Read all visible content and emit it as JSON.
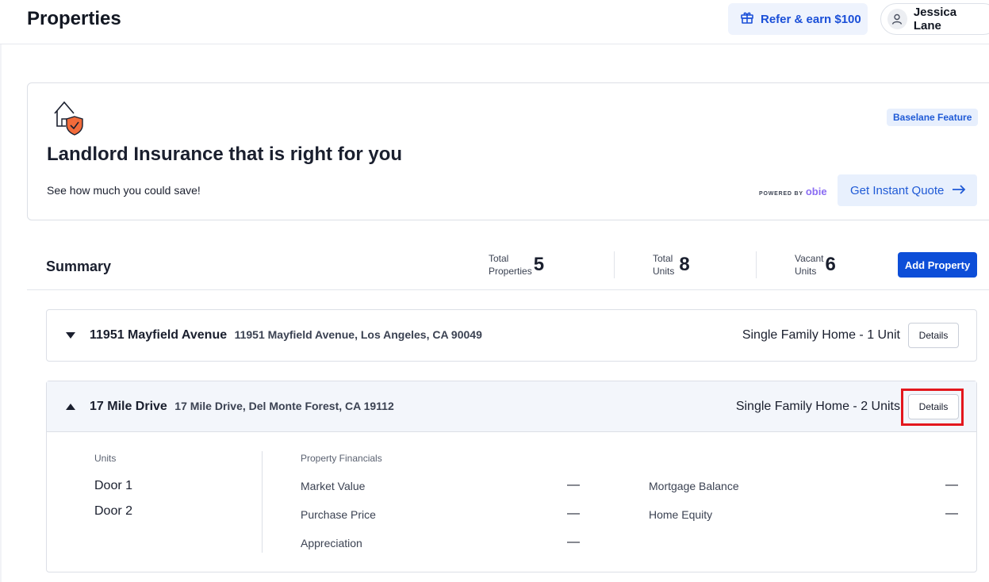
{
  "header": {
    "title": "Properties",
    "refer_label": "Refer & earn $100",
    "user_name": "Jessica Lane"
  },
  "promo": {
    "badge": "Baselane Feature",
    "title": "Landlord Insurance that is right for you",
    "subtitle": "See how much you could save!",
    "powered_by": "POWERED BY",
    "powered_brand": "obie",
    "cta_label": "Get Instant Quote"
  },
  "summary": {
    "title": "Summary",
    "stats": [
      {
        "label_line1": "Total",
        "label_line2": "Properties",
        "value": "5"
      },
      {
        "label_line1": "Total",
        "label_line2": "Units",
        "value": "8"
      },
      {
        "label_line1": "Vacant",
        "label_line2": "Units",
        "value": "6"
      }
    ],
    "add_label": "Add Property"
  },
  "properties": [
    {
      "name": "11951 Mayfield Avenue",
      "address": "11951 Mayfield Avenue, Los Angeles, CA 90049",
      "type": "Single Family Home -  1 Unit",
      "details_label": "Details",
      "expanded": false
    },
    {
      "name": "17 Mile Drive",
      "address": "17 Mile Drive, Del Monte Forest, CA 19112",
      "type": "Single Family Home -  2 Units",
      "details_label": "Details",
      "expanded": true,
      "units_label": "Units",
      "units": [
        "Door 1",
        "Door 2"
      ],
      "financials_label": "Property Financials",
      "financials": {
        "market_value": {
          "label": "Market Value",
          "value": "—"
        },
        "purchase_price": {
          "label": "Purchase Price",
          "value": "—"
        },
        "appreciation": {
          "label": "Appreciation",
          "value": "—"
        },
        "mortgage_balance": {
          "label": "Mortgage Balance",
          "value": "—"
        },
        "home_equity": {
          "label": "Home Equity",
          "value": "—"
        }
      }
    }
  ],
  "colors": {
    "primary": "#0d4ed8",
    "accent_light": "#e8f0fd",
    "highlight": "#e3171d",
    "shield": "#f26b3a"
  }
}
